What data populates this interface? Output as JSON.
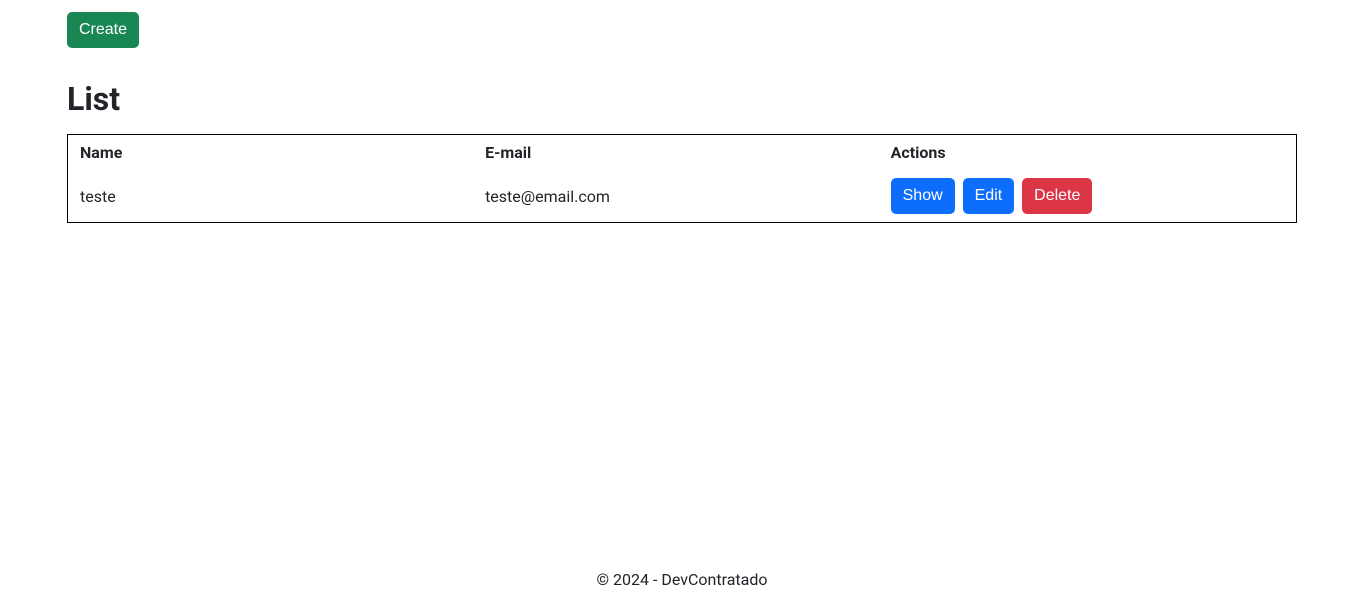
{
  "toolbar": {
    "create_label": "Create"
  },
  "page": {
    "title": "List"
  },
  "table": {
    "headers": {
      "name": "Name",
      "email": "E-mail",
      "actions": "Actions"
    },
    "rows": [
      {
        "name": "teste",
        "email": "teste@email.com"
      }
    ],
    "actions": {
      "show_label": "Show",
      "edit_label": "Edit",
      "delete_label": "Delete"
    }
  },
  "footer": {
    "text": "© 2024 - DevContratado"
  }
}
